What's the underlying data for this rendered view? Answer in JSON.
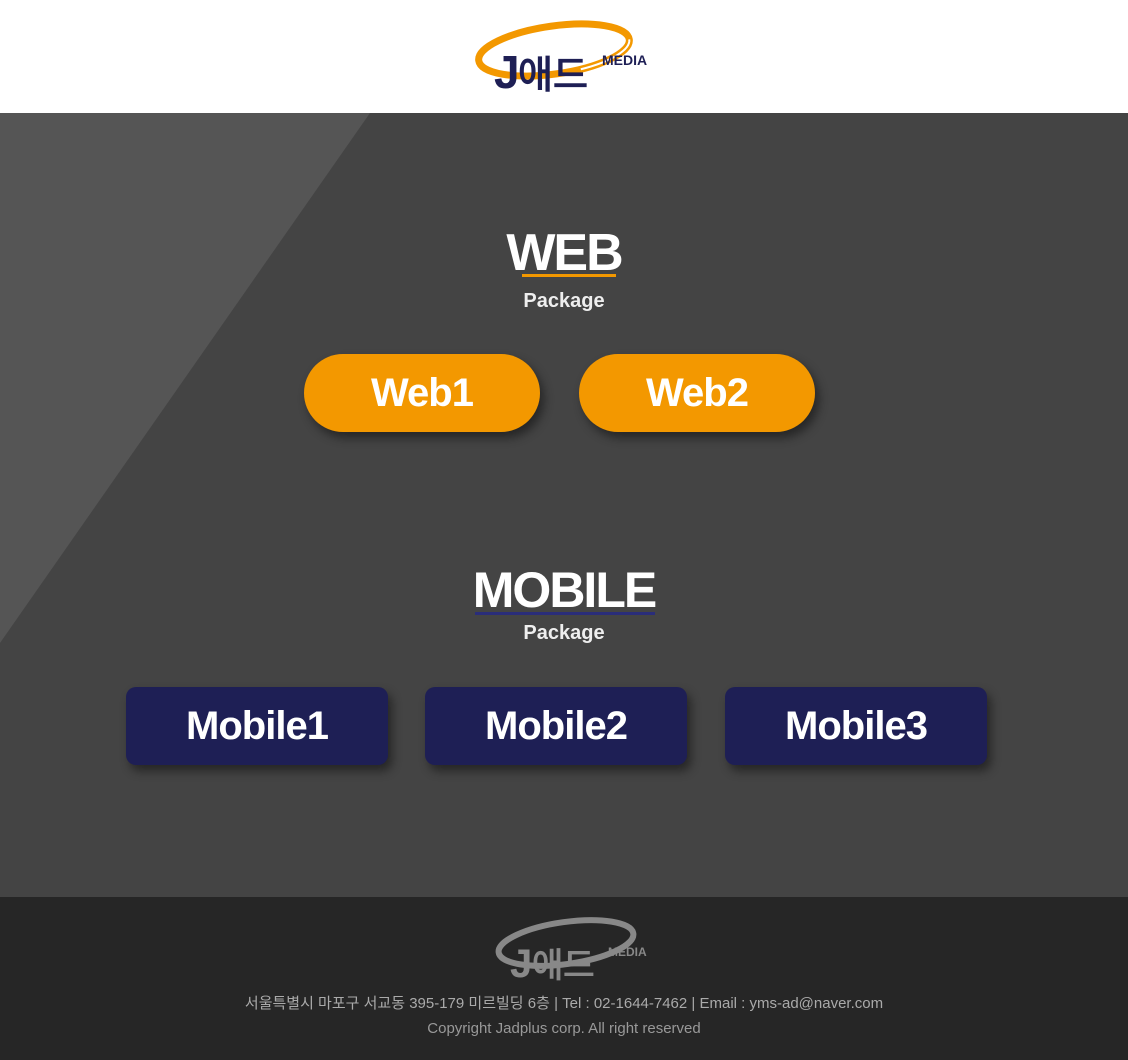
{
  "brand": {
    "logo_j": "J",
    "logo_korean": "애드",
    "logo_media": "MEDIA",
    "accent_color": "#f39800",
    "navy_color": "#1e1f55"
  },
  "web_section": {
    "title": "WEB",
    "subtitle": "Package",
    "buttons": [
      "Web1",
      "Web2"
    ]
  },
  "mobile_section": {
    "title": "MOBILE",
    "subtitle": "Package",
    "buttons": [
      "Mobile1",
      "Mobile2",
      "Mobile3"
    ]
  },
  "footer": {
    "address_line": "서울특별시 마포구 서교동 395-179 미르빌딩 6층 | Tel : 02-1644-7462 | Email : yms-ad@naver.com",
    "copyright": "Copyright Jadplus corp. All right reserved"
  }
}
